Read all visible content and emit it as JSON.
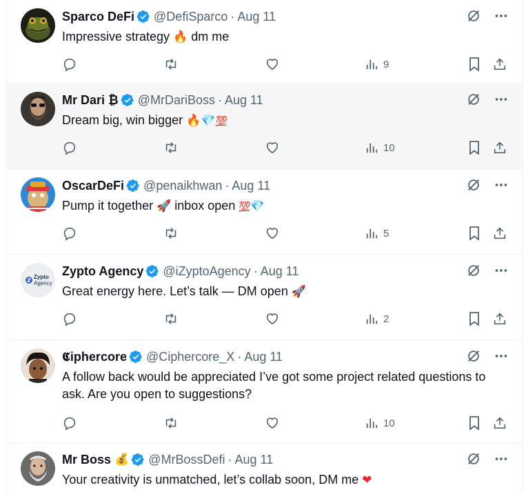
{
  "colors": {
    "verified": "#1d9bf0",
    "secondary": "#536471",
    "text": "#0f1419",
    "hover_bg": "#f7f7f7"
  },
  "tweets": [
    {
      "name": "Sparco DeFi",
      "handle": "@DefiSparco",
      "separator": "·",
      "time": "Aug 11",
      "text_parts": [
        "Impressive strategy ",
        "🔥",
        " dm me"
      ],
      "views": "9",
      "avatar": "frog-avatar"
    },
    {
      "name": "Mr Dari ₿",
      "handle": "@MrDariBoss",
      "separator": "·",
      "time": "Aug 11",
      "text_parts": [
        "Dream big, win bigger ",
        "🔥",
        "💎",
        "💯"
      ],
      "views": "10",
      "avatar": "bearded-man-avatar"
    },
    {
      "name": "OscarDeFi",
      "handle": "@penaikhwan",
      "separator": "·",
      "time": "Aug 11",
      "text_parts": [
        "Pump it together ",
        "🚀",
        " inbox open ",
        "💯",
        "💎"
      ],
      "views": "5",
      "avatar": "ape-avatar"
    },
    {
      "name": "Zypto Agency",
      "handle": "@iZyptoAgency",
      "separator": "·",
      "time": "Aug 11",
      "text_parts": [
        "Great energy here. Let’s talk — DM open ",
        "🚀"
      ],
      "views": "2",
      "avatar": "zypto-logo-avatar",
      "avatar_text": [
        "Zypto",
        "Agency"
      ]
    },
    {
      "name": "𝕮iphercore",
      "handle": "@Ciphercore_X",
      "separator": "·",
      "time": "Aug 11",
      "text_parts": [
        "A follow back would be appreciated I’ve got some project related questions to ask. Are you open to suggestions?"
      ],
      "views": "10",
      "avatar": "anime-avatar"
    },
    {
      "name": "Mr Boss",
      "name_emoji": "💰",
      "handle": "@MrBossDefi",
      "separator": "·",
      "time": "Aug 11",
      "text_parts": [
        "Your creativity is unmatched, let’s collab soon, DM me ",
        "❤"
      ],
      "avatar": "old-man-avatar"
    }
  ]
}
